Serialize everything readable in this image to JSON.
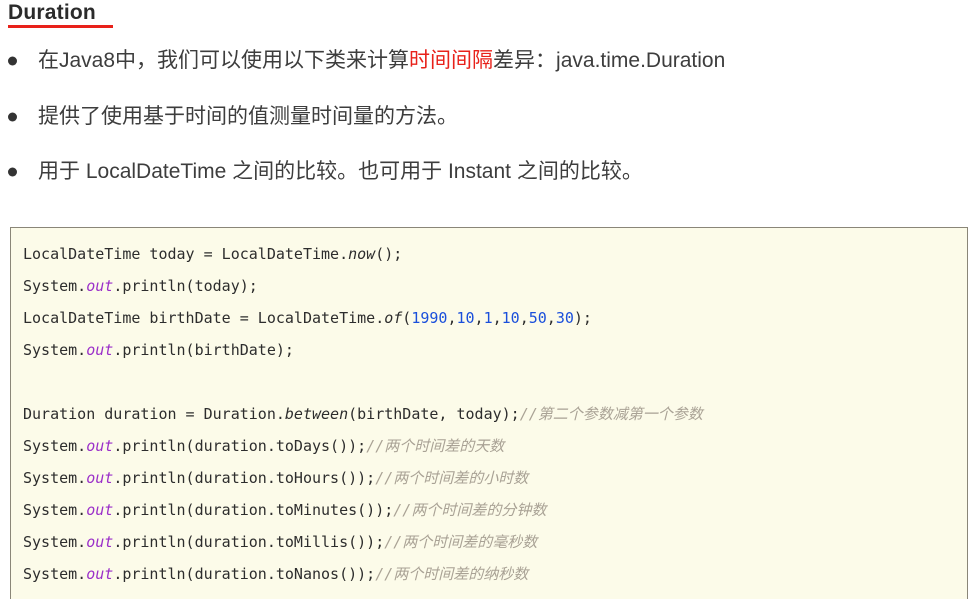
{
  "title": {
    "text": "Duration",
    "underline_color": "#e8211a"
  },
  "bullets": [
    {
      "id": "bullet-1",
      "parts": [
        {
          "text": "在Java8中，我们可以使用以下类来计算",
          "highlight": false
        },
        {
          "text": "时间间隔",
          "highlight": true
        },
        {
          "text": "差异：java.time.Duration",
          "highlight": false
        }
      ]
    },
    {
      "id": "bullet-2",
      "parts": [
        {
          "text": "提供了使用基于时间的值测量时间量的方法。",
          "highlight": false
        }
      ]
    },
    {
      "id": "bullet-3",
      "parts": [
        {
          "text": "用于 LocalDateTime 之间的比较。也可用于 Instant 之间的比较。",
          "highlight": false
        }
      ]
    }
  ],
  "code_block": {
    "language": "java",
    "background": "#fcfbe9",
    "lines": [
      {
        "tokens": [
          {
            "t": "LocalDateTime today = LocalDateTime.",
            "k": "plain"
          },
          {
            "t": "now",
            "k": "method"
          },
          {
            "t": "();",
            "k": "plain"
          }
        ]
      },
      {
        "tokens": [
          {
            "t": "System.",
            "k": "plain"
          },
          {
            "t": "out",
            "k": "field"
          },
          {
            "t": ".println(today);",
            "k": "plain"
          }
        ]
      },
      {
        "tokens": [
          {
            "t": "LocalDateTime birthDate = LocalDateTime.",
            "k": "plain"
          },
          {
            "t": "of",
            "k": "method"
          },
          {
            "t": "(",
            "k": "plain"
          },
          {
            "t": "1990",
            "k": "number"
          },
          {
            "t": ",",
            "k": "plain"
          },
          {
            "t": "10",
            "k": "number"
          },
          {
            "t": ",",
            "k": "plain"
          },
          {
            "t": "1",
            "k": "number"
          },
          {
            "t": ",",
            "k": "plain"
          },
          {
            "t": "10",
            "k": "number"
          },
          {
            "t": ",",
            "k": "plain"
          },
          {
            "t": "50",
            "k": "number"
          },
          {
            "t": ",",
            "k": "plain"
          },
          {
            "t": "30",
            "k": "number"
          },
          {
            "t": ");",
            "k": "plain"
          }
        ]
      },
      {
        "tokens": [
          {
            "t": "System.",
            "k": "plain"
          },
          {
            "t": "out",
            "k": "field"
          },
          {
            "t": ".println(birthDate);",
            "k": "plain"
          }
        ]
      },
      {
        "tokens": []
      },
      {
        "tokens": [
          {
            "t": "Duration duration = Duration.",
            "k": "plain"
          },
          {
            "t": "between",
            "k": "method"
          },
          {
            "t": "(birthDate, today);",
            "k": "plain"
          },
          {
            "t": "//第二个参数减第一个参数",
            "k": "comment"
          }
        ]
      },
      {
        "tokens": [
          {
            "t": "System.",
            "k": "plain"
          },
          {
            "t": "out",
            "k": "field"
          },
          {
            "t": ".println(duration.toDays());",
            "k": "plain"
          },
          {
            "t": "//两个时间差的天数",
            "k": "comment"
          }
        ]
      },
      {
        "tokens": [
          {
            "t": "System.",
            "k": "plain"
          },
          {
            "t": "out",
            "k": "field"
          },
          {
            "t": ".println(duration.toHours());",
            "k": "plain"
          },
          {
            "t": "//两个时间差的小时数",
            "k": "comment"
          }
        ]
      },
      {
        "tokens": [
          {
            "t": "System.",
            "k": "plain"
          },
          {
            "t": "out",
            "k": "field"
          },
          {
            "t": ".println(duration.toMinutes());",
            "k": "plain"
          },
          {
            "t": "//两个时间差的分钟数",
            "k": "comment"
          }
        ]
      },
      {
        "tokens": [
          {
            "t": "System.",
            "k": "plain"
          },
          {
            "t": "out",
            "k": "field"
          },
          {
            "t": ".println(duration.toMillis());",
            "k": "plain"
          },
          {
            "t": "//两个时间差的毫秒数",
            "k": "comment"
          }
        ]
      },
      {
        "tokens": [
          {
            "t": "System.",
            "k": "plain"
          },
          {
            "t": "out",
            "k": "field"
          },
          {
            "t": ".println(duration.toNanos());",
            "k": "plain"
          },
          {
            "t": "//两个时间差的纳秒数",
            "k": "comment"
          }
        ]
      }
    ]
  }
}
